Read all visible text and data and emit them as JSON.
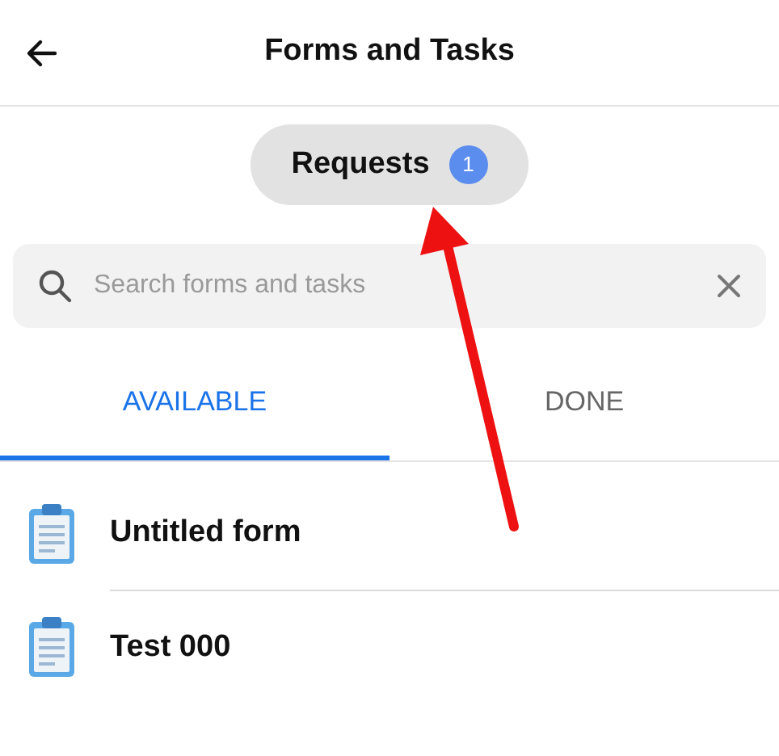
{
  "header": {
    "title": "Forms and Tasks"
  },
  "requests": {
    "label": "Requests",
    "count": "1"
  },
  "search": {
    "placeholder": "Search forms and tasks"
  },
  "tabs": [
    {
      "label": "AVAILABLE",
      "selected": true
    },
    {
      "label": "DONE",
      "selected": false
    }
  ],
  "forms": [
    {
      "name": "Untitled form"
    },
    {
      "name": "Test 000"
    }
  ]
}
